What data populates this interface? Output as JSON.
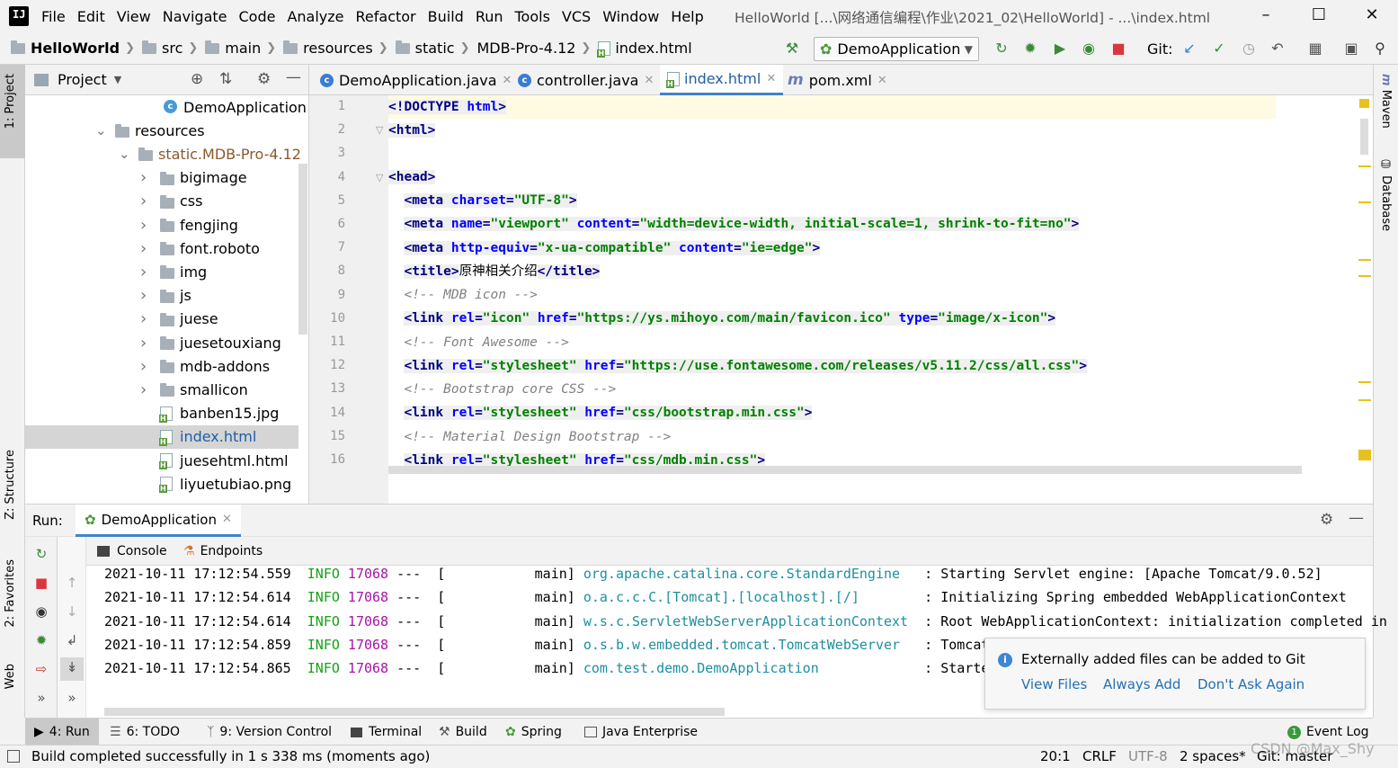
{
  "menu": {
    "items": [
      "File",
      "Edit",
      "View",
      "Navigate",
      "Code",
      "Analyze",
      "Refactor",
      "Build",
      "Run",
      "Tools",
      "VCS",
      "Window",
      "Help"
    ],
    "window_title": "HelloWorld [...\\网络通信编程\\作业\\2021_02\\HelloWorld] - ...\\index.html"
  },
  "breadcrumb": [
    "HelloWorld",
    "src",
    "main",
    "resources",
    "static",
    "MDB-Pro-4.12",
    "index.html"
  ],
  "toolbar": {
    "run_config": "DemoApplication",
    "git_label": "Git:"
  },
  "left_strip": {
    "project": "1: Project",
    "structure": "Z: Structure",
    "favorites": "2: Favorites",
    "web": "Web"
  },
  "right_strip": {
    "maven": "Maven",
    "database": "Database"
  },
  "project_panel": {
    "title": "Project",
    "tree": [
      {
        "label": "DemoApplication",
        "kind": "class",
        "indent": 0
      },
      {
        "label": "resources",
        "kind": "folder",
        "indent": 0
      },
      {
        "label": "static.MDB-Pro-4.12",
        "kind": "folder",
        "indent": 1
      },
      {
        "label": "bigimage",
        "kind": "folder",
        "indent": 2
      },
      {
        "label": "css",
        "kind": "folder",
        "indent": 2
      },
      {
        "label": "fengjing",
        "kind": "folder",
        "indent": 2
      },
      {
        "label": "font.roboto",
        "kind": "folder",
        "indent": 2
      },
      {
        "label": "img",
        "kind": "folder",
        "indent": 2
      },
      {
        "label": "js",
        "kind": "folder",
        "indent": 2
      },
      {
        "label": "juese",
        "kind": "folder",
        "indent": 2
      },
      {
        "label": "juesetouxiang",
        "kind": "folder",
        "indent": 2
      },
      {
        "label": "mdb-addons",
        "kind": "folder",
        "indent": 2
      },
      {
        "label": "smallicon",
        "kind": "folder",
        "indent": 2
      },
      {
        "label": "banben15.jpg",
        "kind": "image",
        "indent": 2
      },
      {
        "label": "index.html",
        "kind": "html",
        "indent": 2
      },
      {
        "label": "juesehtml.html",
        "kind": "html",
        "indent": 2
      },
      {
        "label": "liyuetubiao.png",
        "kind": "image",
        "indent": 2
      }
    ]
  },
  "editor": {
    "tabs": [
      "DemoApplication.java",
      "controller.java",
      "index.html",
      "pom.xml"
    ],
    "active_tab": "index.html",
    "line_numbers": [
      "1",
      "2",
      "3",
      "4",
      "5",
      "6",
      "7",
      "8",
      "9",
      "10",
      "11",
      "12",
      "13",
      "14",
      "15",
      "16"
    ]
  },
  "run_panel": {
    "label": "Run:",
    "config": "DemoApplication",
    "subtabs": [
      "Console",
      "Endpoints"
    ],
    "log": [
      {
        "ts": "2021-10-11 17:12:54.559",
        "level": "INFO",
        "pid": "17068",
        "thread": "---  [           main]",
        "logger": "org.apache.catalina.core.StandardEngine  ",
        "msg": ": Starting Servlet engine: [Apache Tomcat/9.0.52]"
      },
      {
        "ts": "2021-10-11 17:12:54.614",
        "level": "INFO",
        "pid": "17068",
        "thread": "---  [           main]",
        "logger": "o.a.c.c.C.[Tomcat].[localhost].[/]       ",
        "msg": ": Initializing Spring embedded WebApplicationContext"
      },
      {
        "ts": "2021-10-11 17:12:54.614",
        "level": "INFO",
        "pid": "17068",
        "thread": "---  [           main]",
        "logger": "w.s.c.ServletWebServerApplicationContext ",
        "msg": ": Root WebApplicationContext: initialization completed in"
      },
      {
        "ts": "2021-10-11 17:12:54.859",
        "level": "INFO",
        "pid": "17068",
        "thread": "---  [           main]",
        "logger": "o.s.b.w.embedded.tomcat.TomcatWebServer  ",
        "msg": ": Tomcat s"
      },
      {
        "ts": "2021-10-11 17:12:54.865",
        "level": "INFO",
        "pid": "17068",
        "thread": "---  [           main]",
        "logger": "com.test.demo.DemoApplication            ",
        "msg": ": Started"
      }
    ]
  },
  "notification": {
    "title": "Externally added files can be added to Git",
    "actions": [
      "View Files",
      "Always Add",
      "Don't Ask Again"
    ]
  },
  "bottom_tabs": [
    "4: Run",
    "6: TODO",
    "9: Version Control",
    "Terminal",
    "Build",
    "Spring",
    "Java Enterprise"
  ],
  "event_log": "Event Log",
  "status": {
    "message": "Build completed successfully in 1 s 338 ms (moments ago)",
    "position": "20:1",
    "line_sep": "CRLF",
    "encoding": "UTF-8",
    "indent": "2 spaces*",
    "git": "Git: master",
    "watermark": "CSDN @Max_Shy"
  }
}
